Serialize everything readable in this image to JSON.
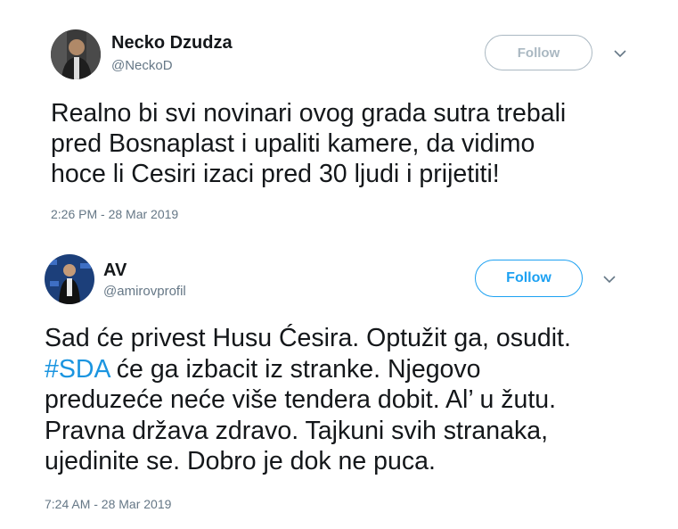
{
  "tweets": [
    {
      "name": "Necko Dzudza",
      "handle": "@NeckoD",
      "follow_label": "Follow",
      "text": "Realno bi svi novinari ovog grada sutra trebali\npred Bosnaplast i upaliti kamere, da vidimo\nhoce li Cesiri izaci pred 30 ljudi i prijetiti!",
      "timestamp": "2:26 PM - 28 Mar 2019"
    },
    {
      "name": "AV",
      "handle": "@amirovprofil",
      "follow_label": "Follow",
      "text_before": "Sad će privest Husu Ćesira. Optužit ga, osudit.\n",
      "hashtag": "#SDA",
      "text_after": " će ga izbacit iz stranke. Njegovo\npreduzeće neće više tendera dobit. Al’ u žutu.\nPravna država zdravo. Tajkuni svih stranaka,\nujedinite se. Dobro je dok ne puca.",
      "timestamp": "7:24 AM - 28 Mar 2019"
    }
  ],
  "colors": {
    "text": "#14171a",
    "secondary": "#657786",
    "link": "#1b95e0",
    "follow_active": "#1da1f2",
    "follow_muted": "#aab8c2"
  }
}
